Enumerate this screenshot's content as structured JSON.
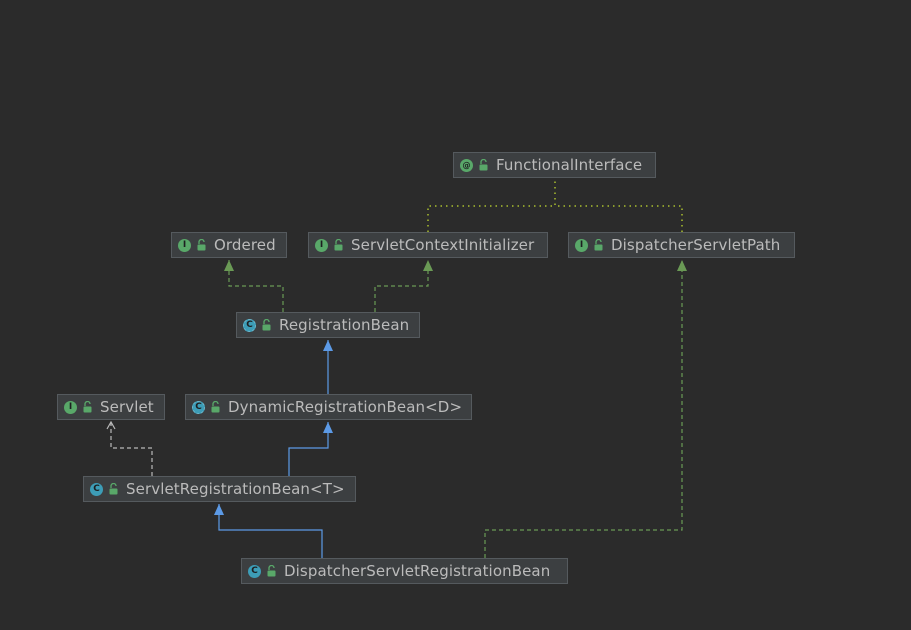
{
  "diagram": {
    "nodes": [
      {
        "id": "functional-interface",
        "label": "FunctionalInterface",
        "kind": "annotation",
        "kind_glyph": "@"
      },
      {
        "id": "ordered",
        "label": "Ordered",
        "kind": "interface",
        "kind_glyph": "I"
      },
      {
        "id": "servlet-context-initializer",
        "label": "ServletContextInitializer",
        "kind": "interface",
        "kind_glyph": "I"
      },
      {
        "id": "dispatcher-servlet-path",
        "label": "DispatcherServletPath",
        "kind": "interface",
        "kind_glyph": "I"
      },
      {
        "id": "registration-bean",
        "label": "RegistrationBean",
        "kind": "abstract-class",
        "kind_glyph": "C"
      },
      {
        "id": "servlet",
        "label": "Servlet",
        "kind": "interface",
        "kind_glyph": "I"
      },
      {
        "id": "dynamic-registration-bean",
        "label": "DynamicRegistrationBean<D>",
        "kind": "abstract-class",
        "kind_glyph": "C"
      },
      {
        "id": "servlet-registration-bean",
        "label": "ServletRegistrationBean<T>",
        "kind": "class",
        "kind_glyph": "C"
      },
      {
        "id": "dispatcher-servlet-registration-bean",
        "label": "DispatcherServletRegistrationBean",
        "kind": "class",
        "kind_glyph": "C"
      }
    ],
    "edges": [
      {
        "from": "servlet-context-initializer",
        "to": "functional-interface",
        "style": "annotation"
      },
      {
        "from": "dispatcher-servlet-path",
        "to": "functional-interface",
        "style": "annotation"
      },
      {
        "from": "registration-bean",
        "to": "ordered",
        "style": "implements"
      },
      {
        "from": "registration-bean",
        "to": "servlet-context-initializer",
        "style": "implements"
      },
      {
        "from": "dynamic-registration-bean",
        "to": "registration-bean",
        "style": "extends"
      },
      {
        "from": "servlet-registration-bean",
        "to": "dynamic-registration-bean",
        "style": "extends"
      },
      {
        "from": "servlet-registration-bean",
        "to": "servlet",
        "style": "uses"
      },
      {
        "from": "dispatcher-servlet-registration-bean",
        "to": "servlet-registration-bean",
        "style": "extends"
      },
      {
        "from": "dispatcher-servlet-registration-bean",
        "to": "dispatcher-servlet-path",
        "style": "implements"
      }
    ],
    "colors": {
      "background": "#2b2b2b",
      "node_fill": "#3c3f41",
      "node_border": "#555a5e",
      "text": "#bbbbbb",
      "extends": "#5c9ae6",
      "implements": "#6a9a55",
      "annotation": "#8a9a2e",
      "uses": "#b8b8b8"
    }
  }
}
